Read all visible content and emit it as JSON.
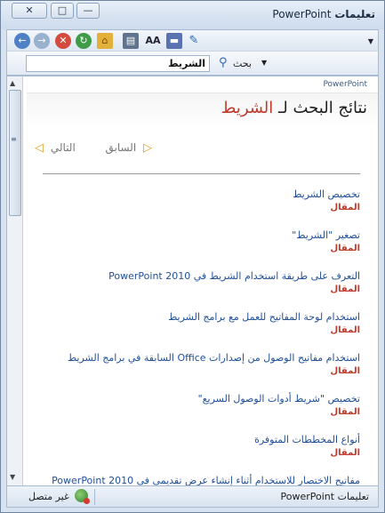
{
  "window": {
    "title_app": "PowerPoint",
    "title_word": "تعليمات",
    "close_glyph": "✕",
    "max_glyph": "□",
    "min_glyph": "—"
  },
  "toolbar": {
    "back_glyph": "←",
    "fwd_glyph": "→",
    "stop_glyph": "✕",
    "refresh_glyph": "↻",
    "home_glyph": "⌂",
    "print_glyph": "▤",
    "font_glyph": "AA",
    "book_glyph": "▬",
    "pin_glyph": "✎",
    "dropdown_glyph": "▼"
  },
  "search": {
    "value": "الشريط",
    "label": "بحث",
    "icon_glyph": "⚲",
    "chevron_glyph": "▼",
    "drop_glyph": "▼"
  },
  "content": {
    "breadcrumb": "PowerPoint",
    "title_prefix": "نتائج البحث لـ ",
    "title_term": "الشريط",
    "prev_label": "السابق",
    "next_label": "التالي",
    "prev_glyph": "◁",
    "next_glyph": "▷",
    "results": [
      {
        "title": "تخصيص الشريط",
        "kind": "المقال"
      },
      {
        "title": "تصغير \"الشريط\"",
        "kind": "المقال"
      },
      {
        "title": "التعرف على طريقة استخدام الشريط في PowerPoint 2010",
        "kind": "المقال"
      },
      {
        "title": "استخدام لوحة المفاتيح للعمل مع برامج الشريط",
        "kind": "المقال"
      },
      {
        "title": "استخدام مفاتيح الوصول من إصدارات Office السابقة في برامج الشريط",
        "kind": "المقال"
      },
      {
        "title": "تخصيص \"شريط أدوات الوصول السريع\"",
        "kind": "المقال"
      },
      {
        "title": "أنواع المخططات المتوفرة",
        "kind": "المقال"
      },
      {
        "title": "مفاتيح الاختصار للاستخدام أثناء إنشاء عرض تقديمي في PowerPoint 2010",
        "kind": ""
      }
    ]
  },
  "scrollbar": {
    "up_glyph": "▲",
    "down_glyph": "▼",
    "grip_glyph": "≡"
  },
  "status": {
    "help_label": "تعليمات PowerPoint",
    "connection_label": "غير متصل"
  }
}
